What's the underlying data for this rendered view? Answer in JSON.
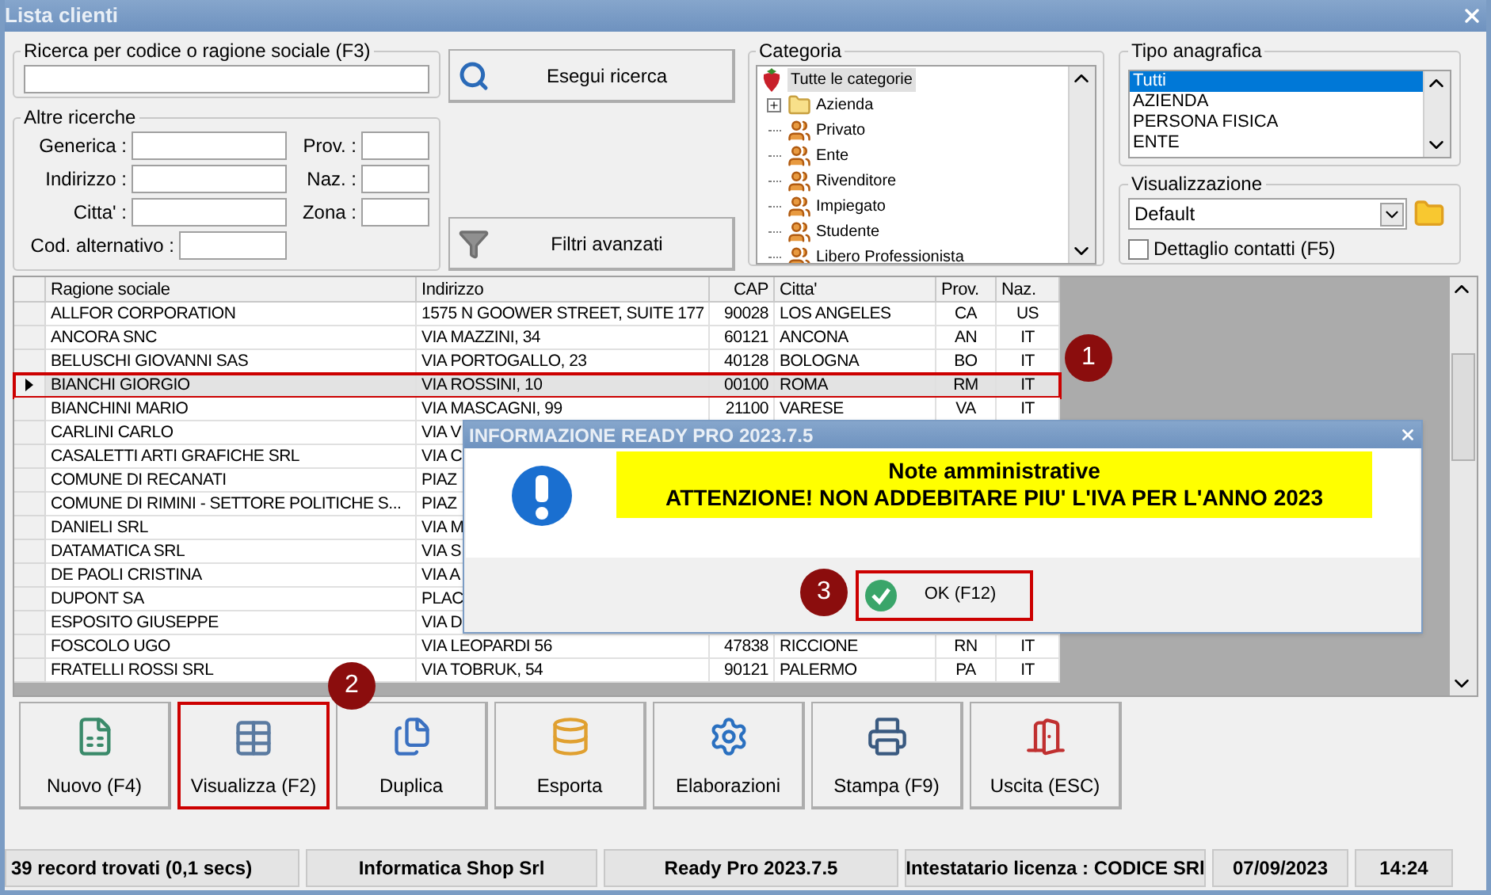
{
  "window": {
    "title": "Lista clienti"
  },
  "search": {
    "label": "Ricerca per codice o ragione sociale (F3)",
    "button": "Esegui ricerca"
  },
  "other_searches": {
    "label": "Altre ricerche",
    "left_fields": [
      {
        "label": "Generica :",
        "kind": "wide"
      },
      {
        "label": "Indirizzo :",
        "kind": "wide"
      },
      {
        "label": "Citta' :",
        "kind": "wide"
      },
      {
        "label": "Cod. alternativo :",
        "kind": "short"
      }
    ],
    "right_fields": [
      {
        "label": "Prov. :"
      },
      {
        "label": "Naz. :"
      },
      {
        "label": "Zona :"
      }
    ]
  },
  "advanced_filters_button": "Filtri avanzati",
  "category": {
    "label": "Categoria",
    "root": {
      "label": "Tutte le categorie",
      "selected": true,
      "children": [
        {
          "label": "Azienda",
          "kind": "folder",
          "expanded": false,
          "selected": false
        },
        {
          "label": "Privato",
          "kind": "people",
          "selected": false
        },
        {
          "label": "Ente",
          "kind": "people",
          "selected": false
        },
        {
          "label": "Rivenditore",
          "kind": "people",
          "selected": false
        },
        {
          "label": "Impiegato",
          "kind": "people",
          "selected": false
        },
        {
          "label": "Studente",
          "kind": "people",
          "selected": false
        },
        {
          "label": "Libero Professionista",
          "kind": "people",
          "selected": false
        }
      ]
    }
  },
  "record_type": {
    "label": "Tipo anagrafica",
    "items": [
      {
        "label": "Tutti",
        "selected": true
      },
      {
        "label": "AZIENDA",
        "selected": false
      },
      {
        "label": "PERSONA FISICA",
        "selected": false
      },
      {
        "label": "ENTE",
        "selected": false
      }
    ]
  },
  "view": {
    "label": "Visualizzazione",
    "value": "Default",
    "contact_detail": {
      "label": "Dettaglio contatti (F5)",
      "checked": false
    }
  },
  "table": {
    "columns": [
      "Ragione sociale",
      "Indirizzo",
      "CAP",
      "Citta'",
      "Prov.",
      "Naz."
    ],
    "rows": [
      {
        "cells": [
          "ALLFOR CORPORATION",
          "1575 N GOOWER STREET, SUITE 177",
          "90028",
          "LOS ANGELES",
          "CA",
          "US"
        ],
        "current": false,
        "highlighted": false
      },
      {
        "cells": [
          "ANCORA SNC",
          "VIA MAZZINI, 34",
          "60121",
          "ANCONA",
          "AN",
          "IT"
        ],
        "current": false,
        "highlighted": false
      },
      {
        "cells": [
          "BELUSCHI GIOVANNI SAS",
          "VIA PORTOGALLO, 23",
          "40128",
          "BOLOGNA",
          "BO",
          "IT"
        ],
        "current": false,
        "highlighted": false
      },
      {
        "cells": [
          "BIANCHI GIORGIO",
          "VIA ROSSINI, 10",
          "00100",
          "ROMA",
          "RM",
          "IT"
        ],
        "current": true,
        "highlighted": true,
        "callout": "1"
      },
      {
        "cells": [
          "BIANCHINI MARIO",
          "VIA MASCAGNI, 99",
          "21100",
          "VARESE",
          "VA",
          "IT"
        ],
        "current": false,
        "highlighted": false
      },
      {
        "cells": [
          "CARLINI CARLO",
          "VIA V"
        ],
        "current": false,
        "highlighted": false
      },
      {
        "cells": [
          "CASALETTI ARTI GRAFICHE SRL",
          "VIA C"
        ],
        "current": false,
        "highlighted": false
      },
      {
        "cells": [
          "COMUNE DI RECANATI",
          "PIAZ"
        ],
        "current": false,
        "highlighted": false
      },
      {
        "cells": [
          "COMUNE DI RIMINI - SETTORE POLITICHE S...",
          "PIAZ"
        ],
        "current": false,
        "highlighted": false
      },
      {
        "cells": [
          "DANIELI SRL",
          "VIA M"
        ],
        "current": false,
        "highlighted": false
      },
      {
        "cells": [
          "DATAMATICA SRL",
          "VIA S"
        ],
        "current": false,
        "highlighted": false
      },
      {
        "cells": [
          "DE PAOLI CRISTINA",
          "VIA A"
        ],
        "current": false,
        "highlighted": false
      },
      {
        "cells": [
          "DUPONT SA",
          "PLAC"
        ],
        "current": false,
        "highlighted": false
      },
      {
        "cells": [
          "ESPOSITO GIUSEPPE",
          "VIA D"
        ],
        "current": false,
        "highlighted": false
      },
      {
        "cells": [
          "FOSCOLO UGO",
          "VIA LEOPARDI 56",
          "47838",
          "RICCIONE",
          "RN",
          "IT"
        ],
        "current": false,
        "highlighted": false
      },
      {
        "cells": [
          "FRATELLI ROSSI SRL",
          "VIA TOBRUK, 54",
          "90121",
          "PALERMO",
          "PA",
          "IT"
        ],
        "current": false,
        "highlighted": false
      }
    ]
  },
  "dialog": {
    "title": "INFORMAZIONE READY PRO 2023.7.5",
    "heading": "Note amministrative",
    "message": "ATTENZIONE! NON ADDEBITARE PIU' L'IVA PER L'ANNO 2023",
    "button": {
      "label": "OK (F12)",
      "highlighted": true,
      "callout": "3"
    }
  },
  "toolbar": [
    {
      "label": "Nuovo (F4)",
      "highlighted": false
    },
    {
      "label": "Visualizza (F2)",
      "highlighted": true,
      "callout": "2"
    },
    {
      "label": "Duplica",
      "highlighted": false
    },
    {
      "label": "Esporta",
      "highlighted": false
    },
    {
      "label": "Elaborazioni",
      "highlighted": false
    },
    {
      "label": "Stampa (F9)",
      "highlighted": false
    },
    {
      "label": "Uscita (ESC)",
      "highlighted": false
    }
  ],
  "status_bar": [
    "39 record trovati (0,1 secs)",
    "Informatica Shop Srl",
    "Ready Pro 2023.7.5",
    "Intestatario licenza : CODICE SRl",
    "07/09/2023",
    "14:24"
  ]
}
